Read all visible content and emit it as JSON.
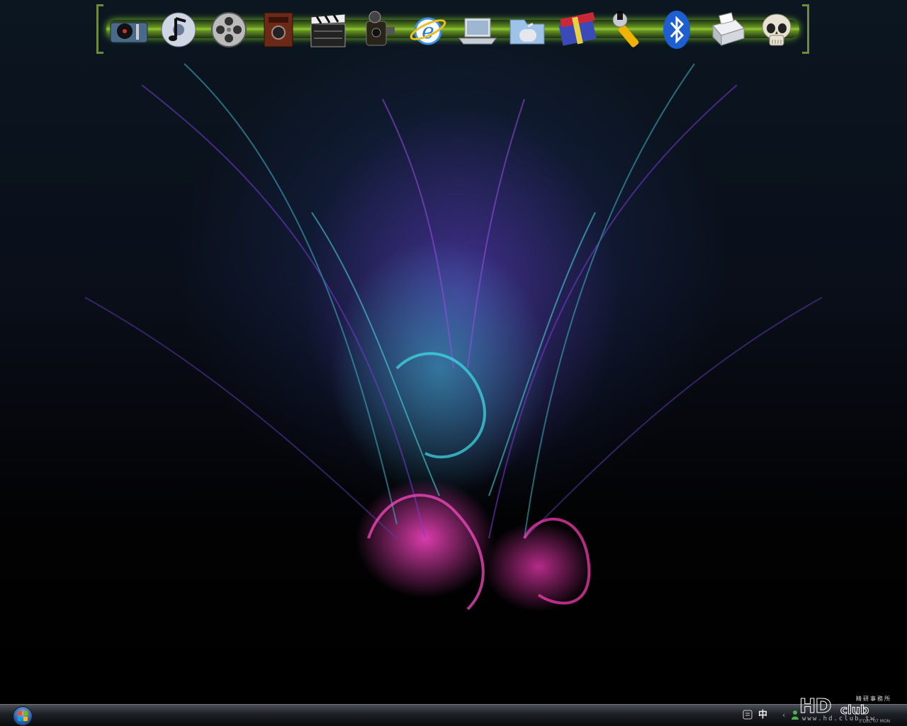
{
  "dock": {
    "items": [
      {
        "name": "turntable",
        "icon": "turntable-icon"
      },
      {
        "name": "music-note",
        "icon": "music-note-icon"
      },
      {
        "name": "film-reel",
        "icon": "film-reel-icon"
      },
      {
        "name": "vintage-camera",
        "icon": "vintage-camera-icon"
      },
      {
        "name": "clapperboard",
        "icon": "clapperboard-icon"
      },
      {
        "name": "movie-camera",
        "icon": "movie-camera-icon"
      },
      {
        "name": "internet-explorer",
        "icon": "internet-explorer-icon"
      },
      {
        "name": "laptop",
        "icon": "laptop-icon"
      },
      {
        "name": "apple-folder",
        "icon": "apple-folder-icon"
      },
      {
        "name": "winrar",
        "icon": "winrar-icon"
      },
      {
        "name": "wrench",
        "icon": "wrench-icon"
      },
      {
        "name": "bluetooth",
        "icon": "bluetooth-icon"
      },
      {
        "name": "printer",
        "icon": "printer-icon"
      },
      {
        "name": "skull",
        "icon": "skull-icon"
      }
    ],
    "accent": "#9cff30"
  },
  "taskbar": {
    "ime_label": "中",
    "tray_arrow": "‹",
    "colors": {
      "bar_top": "#4a4f57",
      "bar_bottom": "#0a0b0d"
    }
  },
  "watermark": {
    "logo": "HD",
    "club": "club",
    "chinese": "精研事務所",
    "url": "www.hd.club.tw"
  },
  "clock": {
    "date": "5 DEC 07 MON"
  }
}
